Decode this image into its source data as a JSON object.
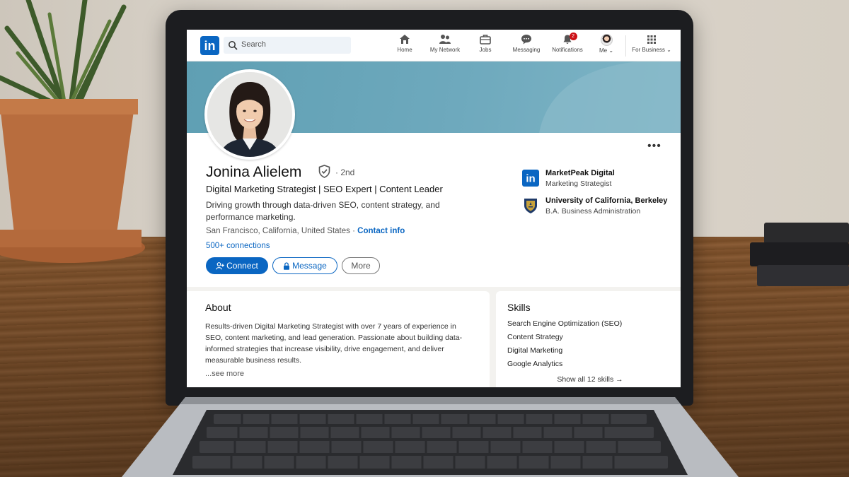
{
  "nav": {
    "search_placeholder": "Search",
    "items": [
      {
        "label": "Home",
        "icon": "home-icon"
      },
      {
        "label": "My Network",
        "icon": "network-icon"
      },
      {
        "label": "Jobs",
        "icon": "briefcase-icon"
      },
      {
        "label": "Messaging",
        "icon": "chat-icon"
      },
      {
        "label": "Notifications",
        "icon": "bell-icon",
        "badge": "2"
      },
      {
        "label": "Me",
        "icon": "avatar-icon"
      },
      {
        "label": "For Business",
        "icon": "grid-icon"
      }
    ],
    "logo_text": "in"
  },
  "profile": {
    "name": "Jonina Alielem",
    "degree": "· 2nd",
    "headline": "Digital Marketing Strategist | SEO Expert | Content Leader",
    "summary": "Driving growth through data-driven SEO, content strategy, and performance marketing.",
    "location": "San Francisco, California, United States ·",
    "contact_link": "Contact info",
    "connections": "500+ connections",
    "buttons": {
      "connect": "Connect",
      "message": "Message",
      "more": "More"
    },
    "experience": [
      {
        "title": "MarketPeak Digital",
        "subtitle": "Marketing Strategist",
        "icon": "linkedin-logo-icon"
      },
      {
        "title": "University of California, Berkeley",
        "subtitle": "B.A. Business Administration",
        "icon": "university-crest-icon"
      }
    ]
  },
  "about": {
    "title": "About",
    "text": "Results-driven Digital Marketing Strategist with over 7 years of experience in SEO, content marketing, and lead generation. Passionate about building data-informed strategies that increase visibility, drive engagement, and deliver measurable business results.",
    "see_more": "...see more"
  },
  "skills": {
    "title": "Skills",
    "items": [
      "Search Engine Optimization (SEO)",
      "Content Strategy",
      "Digital Marketing",
      "Google Analytics"
    ],
    "show_all": "Show all 12 skills →"
  },
  "colors": {
    "brand": "#0a66c2",
    "cover": "#6ea9bd",
    "badge": "#cc1016"
  }
}
